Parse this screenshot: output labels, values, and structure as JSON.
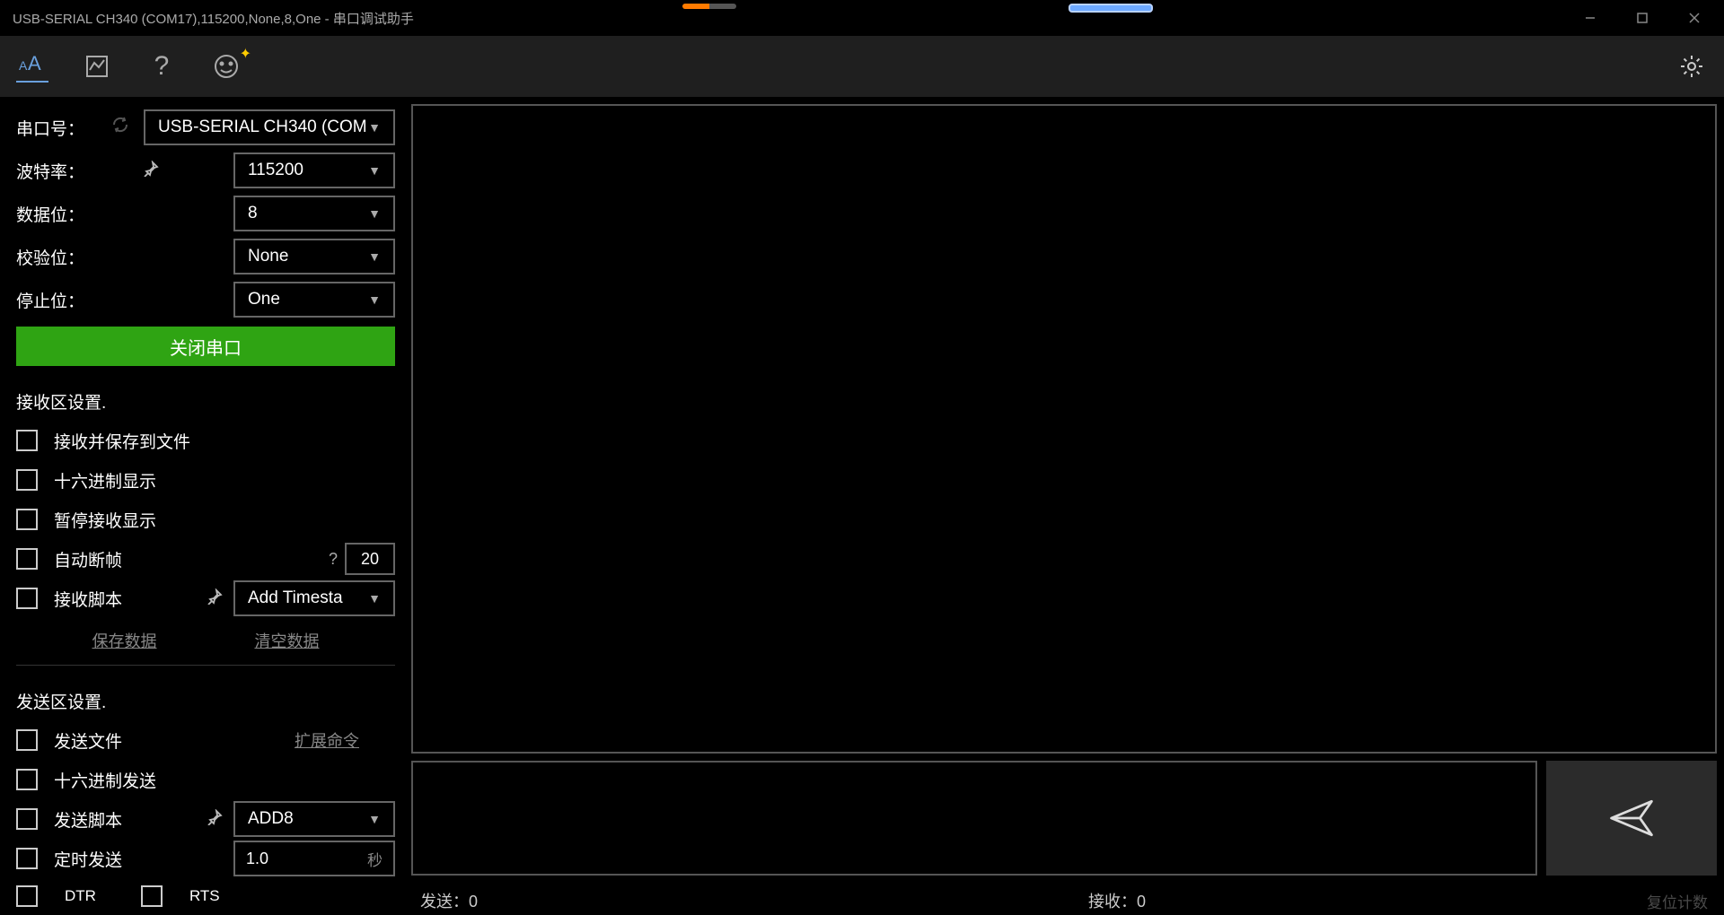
{
  "window": {
    "title": "USB-SERIAL CH340 (COM17),115200,None,8,One - 串口调试助手"
  },
  "port": {
    "label": "串口号：",
    "value": "USB-SERIAL CH340 (COM"
  },
  "baud": {
    "label": "波特率：",
    "value": "115200"
  },
  "databits": {
    "label": "数据位：",
    "value": "8"
  },
  "parity": {
    "label": "校验位：",
    "value": "None"
  },
  "stopbits": {
    "label": "停止位：",
    "value": "One"
  },
  "close_btn": "关闭串口",
  "recv_section": {
    "title": "接收区设置.",
    "save_to_file": "接收并保存到文件",
    "hex_display": "十六进制显示",
    "pause_display": "暂停接收显示",
    "auto_break": "自动断帧",
    "auto_break_help": "?",
    "auto_break_value": "20",
    "recv_script": "接收脚本",
    "script_value": "Add Timesta",
    "save_data": "保存数据",
    "clear_data": "清空数据"
  },
  "send_section": {
    "title": "发送区设置.",
    "send_file": "发送文件",
    "ext_cmd": "扩展命令",
    "hex_send": "十六进制发送",
    "send_script": "发送脚本",
    "script_value": "ADD8",
    "timed_send": "定时发送",
    "timer_value": "1.0",
    "timer_unit": "秒",
    "dtr": "DTR",
    "rts": "RTS"
  },
  "status": {
    "send_label": "发送：",
    "send_count": "0",
    "recv_label": "接收：",
    "recv_count": "0",
    "reset": "复位计数"
  }
}
